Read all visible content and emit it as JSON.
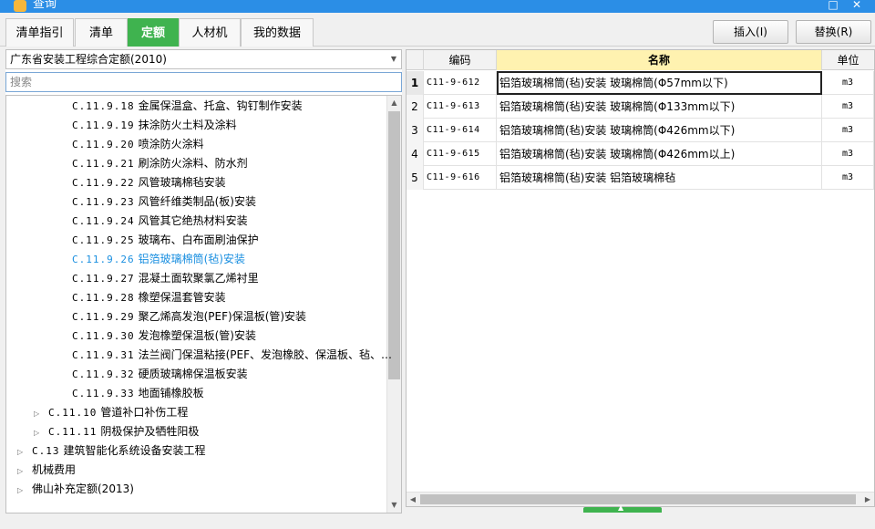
{
  "window": {
    "title": "查询"
  },
  "tabs": [
    {
      "label": "清单指引"
    },
    {
      "label": "清单"
    },
    {
      "label": "定额",
      "active": true
    },
    {
      "label": "人材机"
    },
    {
      "label": "我的数据"
    }
  ],
  "toolbar": {
    "insert_label": "插入(I)",
    "replace_label": "替换(R)"
  },
  "left": {
    "quota_library": "广东省安装工程综合定额(2010)",
    "search_placeholder": "搜索",
    "tree": [
      {
        "code": "C.11.9.18",
        "label": "金属保温盒、托盒、钩钉制作安装",
        "level": 3
      },
      {
        "code": "C.11.9.19",
        "label": "抹涂防火土料及涂料",
        "level": 3
      },
      {
        "code": "C.11.9.20",
        "label": "喷涂防火涂料",
        "level": 3
      },
      {
        "code": "C.11.9.21",
        "label": "刷涂防火涂料、防水剂",
        "level": 3
      },
      {
        "code": "C.11.9.22",
        "label": "风管玻璃棉毡安装",
        "level": 3
      },
      {
        "code": "C.11.9.23",
        "label": "风管纤维类制品(板)安装",
        "level": 3
      },
      {
        "code": "C.11.9.24",
        "label": "风管其它绝热材料安装",
        "level": 3
      },
      {
        "code": "C.11.9.25",
        "label": "玻璃布、白布面刷油保护",
        "level": 3
      },
      {
        "code": "C.11.9.26",
        "label": "铝箔玻璃棉筒(毡)安装",
        "level": 3,
        "selected": true
      },
      {
        "code": "C.11.9.27",
        "label": "混凝土面软聚氯乙烯衬里",
        "level": 3
      },
      {
        "code": "C.11.9.28",
        "label": "橡塑保温套管安装",
        "level": 3
      },
      {
        "code": "C.11.9.29",
        "label": "聚乙烯高发泡(PEF)保温板(管)安装",
        "level": 3
      },
      {
        "code": "C.11.9.30",
        "label": "发泡橡塑保温板(管)安装",
        "level": 3
      },
      {
        "code": "C.11.9.31",
        "label": "法兰阀门保温粘接(PEF、发泡橡胶、保温板、毡、…",
        "level": 3
      },
      {
        "code": "C.11.9.32",
        "label": "硬质玻璃棉保温板安装",
        "level": 3
      },
      {
        "code": "C.11.9.33",
        "label": "地面铺橡胶板",
        "level": 3
      },
      {
        "code": "C.11.10",
        "label": "管道补口补伤工程",
        "level": 2,
        "expandable": true
      },
      {
        "code": "C.11.11",
        "label": "阴极保护及牺牲阳极",
        "level": 2,
        "expandable": true
      },
      {
        "code": "C.13",
        "label": "建筑智能化系统设备安装工程",
        "level": 1,
        "expandable": true
      },
      {
        "code": "",
        "label": "机械费用",
        "level": 1,
        "expandable": true
      },
      {
        "code": "",
        "label": "佛山补充定额(2013)",
        "level": 1,
        "expandable": true
      }
    ]
  },
  "grid": {
    "headers": {
      "code": "编码",
      "name": "名称",
      "unit": "单位"
    },
    "rows": [
      {
        "idx": "1",
        "code": "C11-9-612",
        "name": "铝箔玻璃棉筒(毡)安装 玻璃棉筒(Φ57mm以下)",
        "unit": "m3",
        "active": true
      },
      {
        "idx": "2",
        "code": "C11-9-613",
        "name": "铝箔玻璃棉筒(毡)安装 玻璃棉筒(Φ133mm以下)",
        "unit": "m3"
      },
      {
        "idx": "3",
        "code": "C11-9-614",
        "name": "铝箔玻璃棉筒(毡)安装 玻璃棉筒(Φ426mm以下)",
        "unit": "m3"
      },
      {
        "idx": "4",
        "code": "C11-9-615",
        "name": "铝箔玻璃棉筒(毡)安装 玻璃棉筒(Φ426mm以上)",
        "unit": "m3"
      },
      {
        "idx": "5",
        "code": "C11-9-616",
        "name": "铝箔玻璃棉筒(毡)安装 铝箔玻璃棉毡",
        "unit": "m3"
      }
    ]
  },
  "colors": {
    "accent": "#3fb34f",
    "titlebar": "#2b8ee6",
    "selected_text": "#1a8fe0",
    "name_header": "#fff2b0"
  }
}
